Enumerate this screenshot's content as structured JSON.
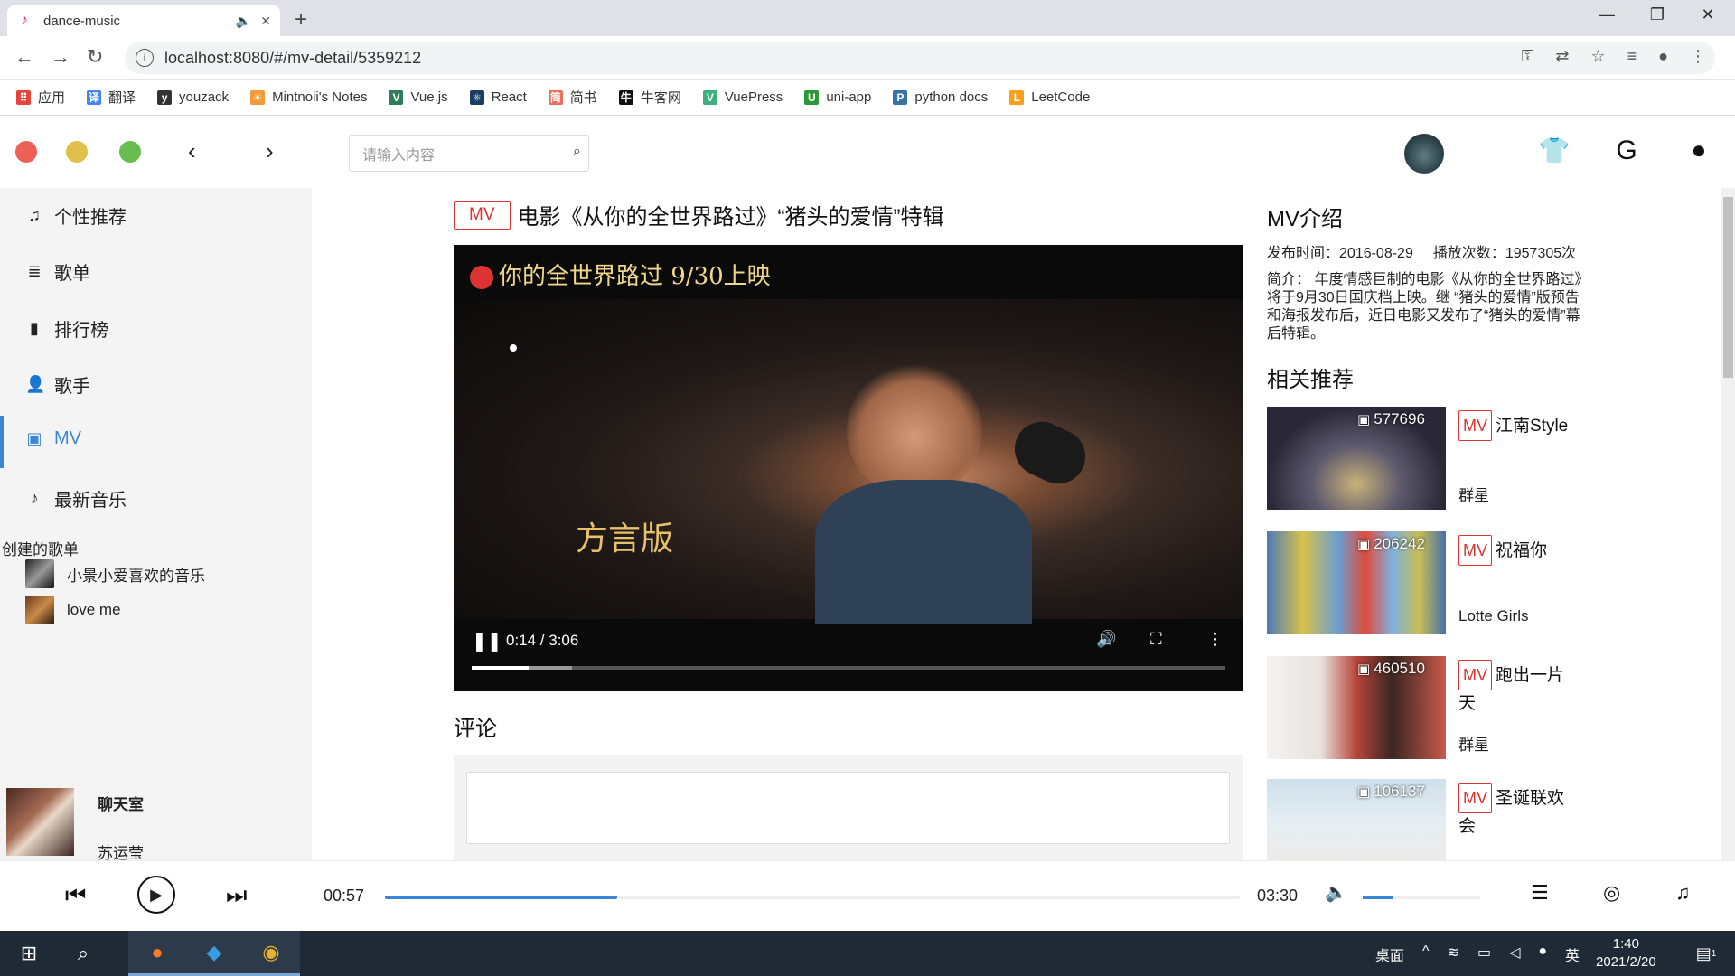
{
  "browser": {
    "tab_title": "dance-music",
    "url": "localhost:8080/#/mv-detail/5359212",
    "bookmarks": [
      {
        "label": "应用",
        "icon": "apps-grid-icon",
        "color": "#e4443b"
      },
      {
        "label": "翻译",
        "icon": "translate-icon",
        "color": "#4285f4"
      },
      {
        "label": "youzack",
        "icon": "youzack-icon",
        "color": "#333333"
      },
      {
        "label": "Mintnoii's Notes",
        "icon": "sun-icon",
        "color": "#f29b38"
      },
      {
        "label": "Vue.js",
        "icon": "vue-icon",
        "color": "#2e7d5b"
      },
      {
        "label": "React",
        "icon": "react-icon",
        "color": "#1a3e63"
      },
      {
        "label": "简书",
        "icon": "jianshu-icon",
        "color": "#ea6f5a"
      },
      {
        "label": "牛客网",
        "icon": "nowcoder-icon",
        "color": "#111111"
      },
      {
        "label": "VuePress",
        "icon": "vuepress-icon",
        "color": "#3eaf7c"
      },
      {
        "label": "uni-app",
        "icon": "uniapp-icon",
        "color": "#2b9939"
      },
      {
        "label": "python docs",
        "icon": "python-icon",
        "color": "#3572a5"
      },
      {
        "label": "LeetCode",
        "icon": "leetcode-icon",
        "color": "#f89f1b"
      }
    ]
  },
  "app": {
    "search_placeholder": "请输入内容",
    "accent": "#3a86d6",
    "sidebar": {
      "items": [
        {
          "label": "个性推荐",
          "icon": "music-note-icon"
        },
        {
          "label": "歌单",
          "icon": "playlist-icon"
        },
        {
          "label": "排行榜",
          "icon": "bar-chart-icon"
        },
        {
          "label": "歌手",
          "icon": "person-icon"
        },
        {
          "label": "MV",
          "icon": "video-icon"
        },
        {
          "label": "最新音乐",
          "icon": "new-music-icon"
        }
      ],
      "created_title": "创建的歌单",
      "playlists": [
        "小景小爱喜欢的音乐",
        "love me"
      ]
    },
    "now_playing": {
      "title": "聊天室",
      "artist": "苏运莹"
    },
    "mv": {
      "tag": "MV",
      "title": "电影《从你的全世界路过》“猪头的爱情”特辑",
      "video_banner": "你的全世界路过  9/30上映",
      "video_overlay_text": "方言版",
      "video_time": "0:14 / 3:06",
      "video_progress": 0.075,
      "comment_heading": "评论"
    },
    "intro": {
      "heading": "MV介绍",
      "publish": "发布时间：2016-08-29",
      "plays": "播放次数：1957305次",
      "desc": "简介：  年度情感巨制的电影《从你的全世界路过》将于9月30日国庆档上映。继 “猪头的爱情”版预告和海报发布后，近日电影又发布了“猪头的爱情”幕后特辑。"
    },
    "related": {
      "heading": "相关推荐",
      "items": [
        {
          "count": "577696",
          "tag": "MV",
          "title": "江南Style",
          "artist": "群星"
        },
        {
          "count": "206242",
          "tag": "MV",
          "title": "祝福你",
          "artist": "Lotte Girls"
        },
        {
          "count": "460510",
          "tag": "MV",
          "title": "跑出一片天",
          "artist": "群星"
        },
        {
          "count": "106137",
          "tag": "MV",
          "title": "圣诞联欢会",
          "artist": ""
        }
      ]
    },
    "player": {
      "current": "00:57",
      "total": "03:30",
      "progress": 0.272,
      "volume": 0.25
    }
  },
  "taskbar": {
    "desktop_label": "桌面",
    "ime": "英",
    "time": "1:40",
    "date": "2021/2/20",
    "notifications": "1"
  }
}
